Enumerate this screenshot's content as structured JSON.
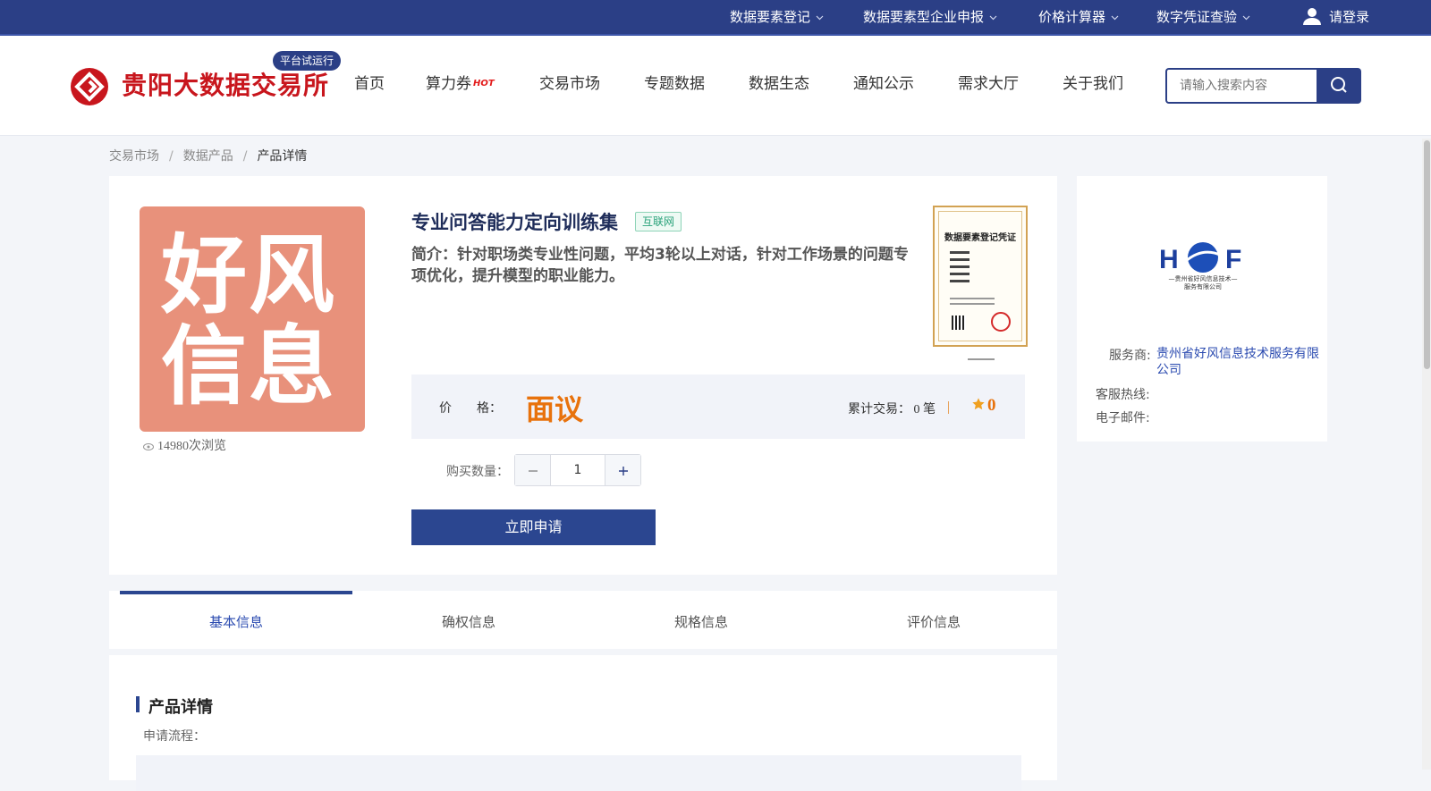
{
  "topbar": {
    "items": [
      "数据要素登记",
      "数据要素型企业申报",
      "价格计算器",
      "数字凭证查验"
    ],
    "login": "请登录"
  },
  "header": {
    "logo_text": "贵阳大数据交易所",
    "trial_badge": "平台试运行",
    "nav": [
      "首页",
      "算力券",
      "交易市场",
      "专题数据",
      "数据生态",
      "通知公示",
      "需求大厅",
      "关于我们"
    ],
    "hot_badge": "HOT",
    "search_placeholder": "请输入搜索内容"
  },
  "breadcrumb": [
    "交易市场",
    "数据产品",
    "产品详情"
  ],
  "product": {
    "image_text": "好风\n信息",
    "views": "14980次浏览",
    "title": "专业问答能力定向训练集",
    "tag": "互联网",
    "intro": "简介：针对职场类专业性问题，平均3轮以上对话，针对工作场景的问题专项优化，提升模型的职业能力。",
    "certificate_title": "数据要素登记凭证",
    "price_label": "价　　格：",
    "price_value": "面议",
    "trade_label": "累计交易：",
    "trade_value": "0",
    "trade_unit": "笔",
    "rating": "0",
    "qty_label": "购买数量：",
    "quantity": "1",
    "apply_button": "立即申请"
  },
  "provider": {
    "logo_caption_1": "—贵州省好风信息技术—",
    "logo_caption_2": "服务有限公司",
    "service_label": "服务商:",
    "service_value": "贵州省好风信息技术服务有限公司",
    "hotline_label": "客服热线:",
    "email_label": "电子邮件:"
  },
  "tabs": [
    "基本信息",
    "确权信息",
    "规格信息",
    "评价信息"
  ],
  "details": {
    "section_title": "产品详情",
    "subtitle": "申请流程："
  },
  "colors": {
    "brand_navy": "#2b3f86",
    "brand_red": "#c8161d",
    "price_orange": "#e8720c",
    "tag_green": "#2aa27a"
  },
  "icons": [
    "chevron-down-icon",
    "user-icon",
    "search-icon",
    "eye-icon",
    "star-icon",
    "minus-icon",
    "plus-icon"
  ]
}
